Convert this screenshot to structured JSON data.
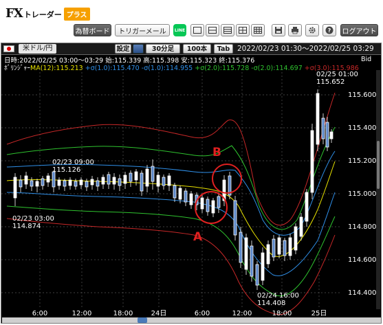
{
  "app": {
    "logo_fx": "FX",
    "logo_trader": "トレーダー",
    "logo_plus": "プラス"
  },
  "toolbar": {
    "rate_board": "為替ボード",
    "trigger_mail": "トリガーメール",
    "line_label": "LINE",
    "logout": "ログアウト"
  },
  "chart_header": {
    "symbol": "米ドル/円",
    "settings": "設定",
    "timeframe": "30分足",
    "count": "100本",
    "tab": "Tab",
    "range": "2022/02/23 01:30〜2022/02/25 03:29"
  },
  "info": {
    "ohlc": "日時:2022/02/25 03:00〜03:29 始:115.339 高:115.398 安:115.323 終:115.376",
    "bid_label": "Bid",
    "bollinger_title": "ﾎﾞﾘﾝｼﾞｬｰ",
    "ma": "MA(12):115.213",
    "p1": "+σ(1.0):115.470",
    "m1": "-σ(1.0):114.955",
    "p2": "+σ(2.0):115.728",
    "m2": "-σ(2.0):114.697",
    "p3": "+σ(3.0):115.986"
  },
  "colors": {
    "ma": "#e8e200",
    "s1": "#2f8fe8",
    "s2": "#2fc42f",
    "s3": "#c82828",
    "candle": "#5a86c8",
    "marker": "#e02020"
  },
  "y_axis": {
    "labels": [
      "115.600",
      "115.400",
      "115.200",
      "115.000",
      "114.800",
      "114.600",
      "114.400"
    ]
  },
  "x_axis": {
    "labels": [
      "6:00",
      "12:00",
      "18:00",
      "24日",
      "6:00",
      "12:00",
      "18:00",
      "25日"
    ]
  },
  "annotations": {
    "a1_date": "02/23 03:00",
    "a1_value": "114.874",
    "a2_date": "02/23 09:00",
    "a2_value": "115.126",
    "a3_date": "02/24 16:00",
    "a3_value": "114.408",
    "a4_date": "02/25 01:00",
    "a4_value": "115.652",
    "marker_a": "A",
    "marker_b": "B"
  }
}
